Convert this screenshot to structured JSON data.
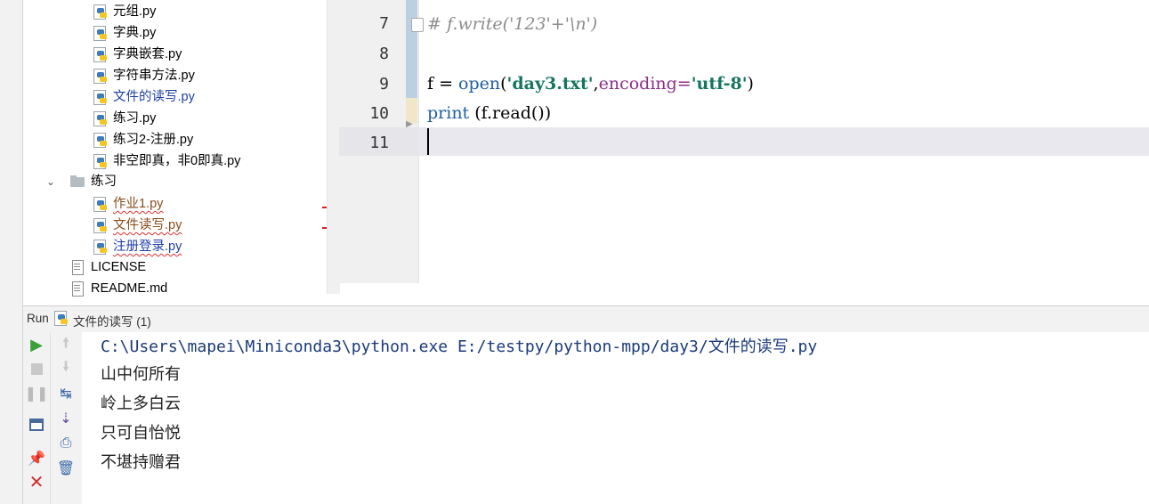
{
  "project_tree": {
    "items": [
      {
        "label": "元组.py",
        "type": "py",
        "status": "normal"
      },
      {
        "label": "字典.py",
        "type": "py",
        "status": "normal"
      },
      {
        "label": "字典嵌套.py",
        "type": "py",
        "status": "normal"
      },
      {
        "label": "字符串方法.py",
        "type": "py",
        "status": "normal"
      },
      {
        "label": "文件的读写.py",
        "type": "py",
        "status": "modified"
      },
      {
        "label": "练习.py",
        "type": "py",
        "status": "normal"
      },
      {
        "label": "练习2-注册.py",
        "type": "py",
        "status": "normal"
      },
      {
        "label": "非空即真，非0即真.py",
        "type": "py",
        "status": "normal"
      },
      {
        "label": "练习",
        "type": "folder",
        "status": "normal"
      },
      {
        "label": "作业1.py",
        "type": "py",
        "status": "error"
      },
      {
        "label": "文件读写.py",
        "type": "py",
        "status": "error"
      },
      {
        "label": "注册登录.py",
        "type": "py",
        "status": "modified-error"
      },
      {
        "label": "LICENSE",
        "type": "text",
        "status": "normal"
      },
      {
        "label": "README.md",
        "type": "text",
        "status": "normal"
      }
    ]
  },
  "editor": {
    "line_numbers": [
      "7",
      "8",
      "9",
      "10",
      "11"
    ],
    "lines": {
      "l7_comment": "# f.write('123'+'\\n')",
      "l9_var": "f = ",
      "l9_open": "open",
      "l9_paren1": "(",
      "l9_str1": "'day3.txt'",
      "l9_comma": ",",
      "l9_param": "encoding=",
      "l9_str2": "'utf-8'",
      "l9_paren2": ")",
      "l10_print": "print",
      "l10_rest": " (f.read())"
    }
  },
  "run_panel": {
    "label": "Run",
    "config_name": "文件的读写 (1)",
    "console_lines": [
      "C:\\Users\\mapei\\Miniconda3\\python.exe E:/testpy/python-mpp/day3/文件的读写.py",
      "山中何所有",
      "岭上多白云",
      "只可自怡悦",
      "不堪持赠君"
    ]
  },
  "colors": {
    "accent_blue": "#1d3fa6",
    "error_red": "#e02020",
    "string_green": "#15755f",
    "run_green": "#3aa13a"
  }
}
